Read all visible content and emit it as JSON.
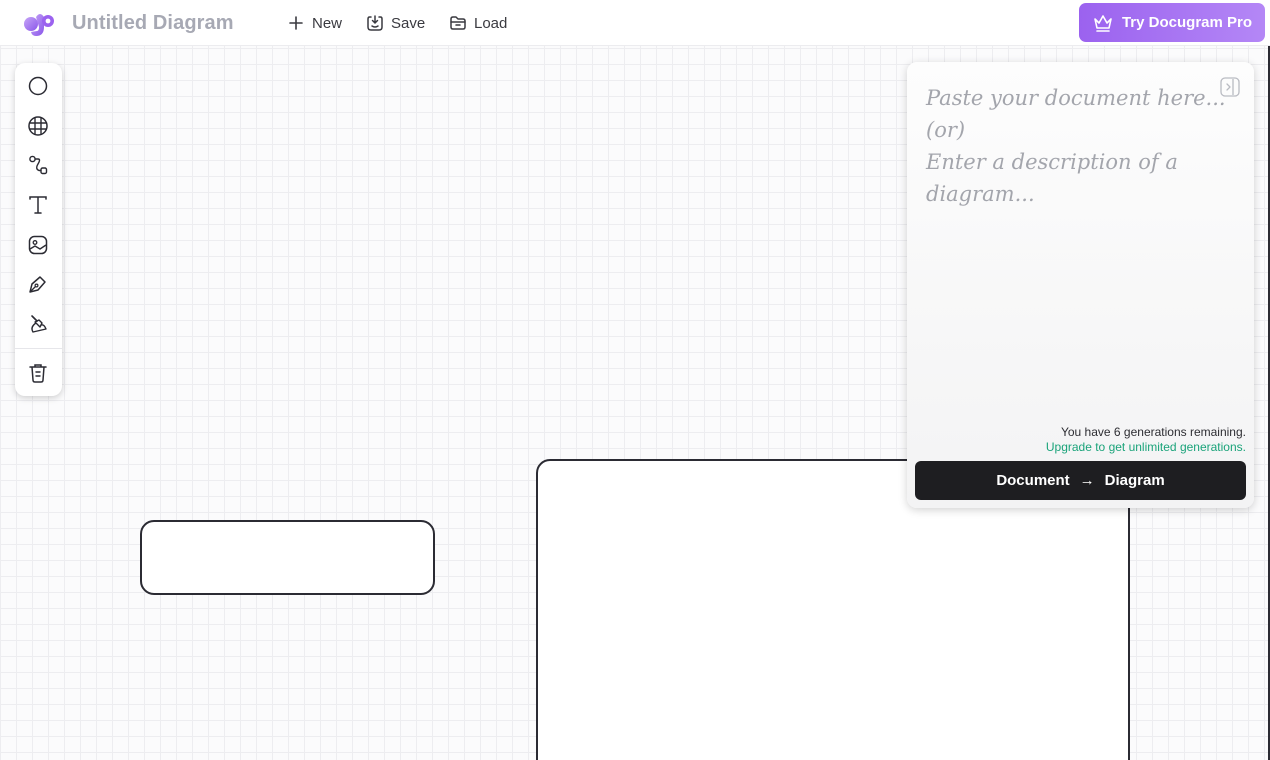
{
  "app": {
    "title": "Untitled Diagram",
    "logo_icon": "docugram-logo-icon",
    "accent_color": "#9b62ef"
  },
  "header": {
    "new_label": "New",
    "save_label": "Save",
    "load_label": "Load",
    "pro_label": "Try Docugram Pro",
    "pro_icon": "crown-icon"
  },
  "toolbar": {
    "tools": [
      {
        "name": "circle-shape-icon"
      },
      {
        "name": "grid-globe-icon"
      },
      {
        "name": "connector-icon"
      },
      {
        "name": "text-icon"
      },
      {
        "name": "image-icon"
      },
      {
        "name": "pen-icon"
      },
      {
        "name": "brush-icon"
      },
      {
        "name": "trash-icon"
      }
    ]
  },
  "panel": {
    "line1": "Paste your document here...",
    "line2": "(or)",
    "line3": "Enter a description of a diagram...",
    "remaining": "You have 6 generations remaining.",
    "upgrade": "Upgrade to get unlimited generations.",
    "button_from": "Document",
    "button_arrow": "→",
    "button_to": "Diagram"
  }
}
